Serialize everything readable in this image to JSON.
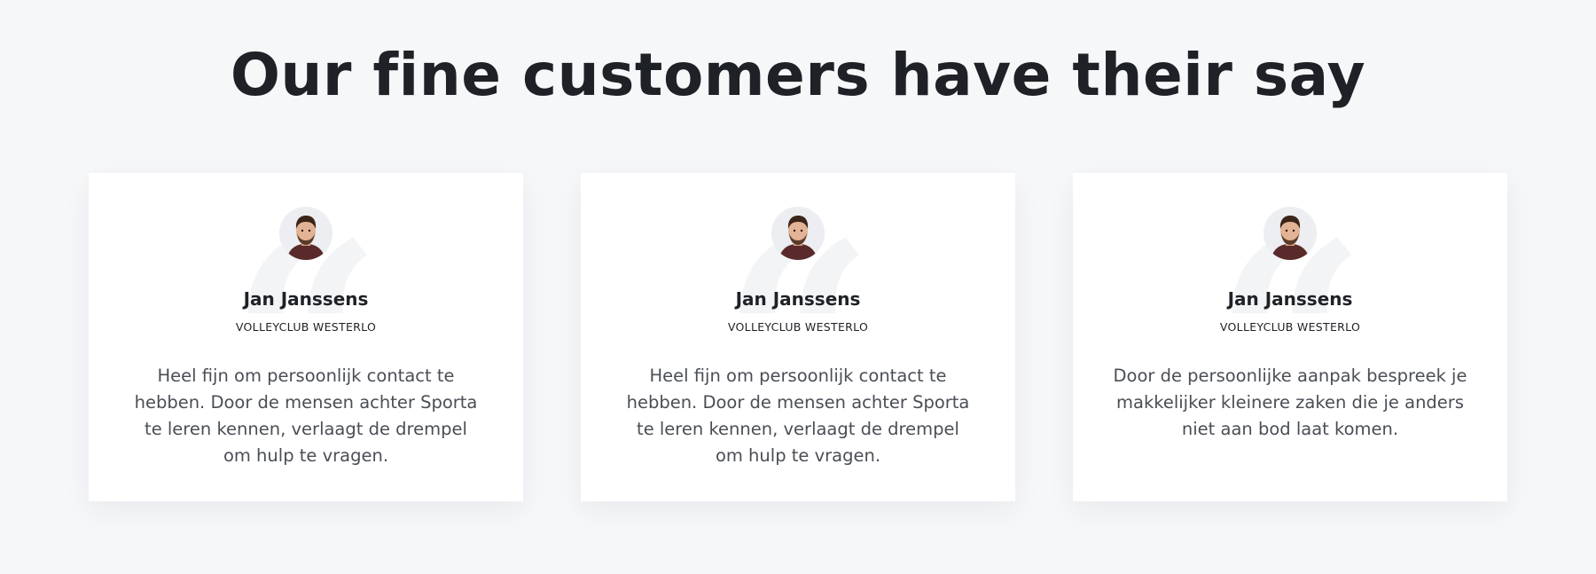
{
  "section": {
    "heading": "Our fine customers have their say"
  },
  "testimonials": [
    {
      "avatar_icon": "person-avatar-icon",
      "name": "Jan Janssens",
      "organization": "VOLLEYCLUB WESTERLO",
      "quote": "Heel fijn om persoonlijk  contact te hebben. Door de mensen achter Sporta te leren kennen, verlaagt de drempel om hulp te vragen."
    },
    {
      "avatar_icon": "person-avatar-icon",
      "name": "Jan Janssens",
      "organization": "VOLLEYCLUB WESTERLO",
      "quote": "Heel fijn om persoonlijk  contact te hebben. Door de mensen achter Sporta te leren kennen, verlaagt de drempel om hulp te vragen."
    },
    {
      "avatar_icon": "person-avatar-icon",
      "name": "Jan Janssens",
      "organization": "VOLLEYCLUB WESTERLO",
      "quote": "Door de persoonlijke aanpak bespreek je makkelijker kleinere zaken die je anders niet aan bod laat komen."
    }
  ],
  "colors": {
    "background": "#f6f7f9",
    "card": "#ffffff",
    "heading": "#1e2126",
    "body_text": "#4a4e55",
    "quote_mark": "#f3f4f6"
  }
}
